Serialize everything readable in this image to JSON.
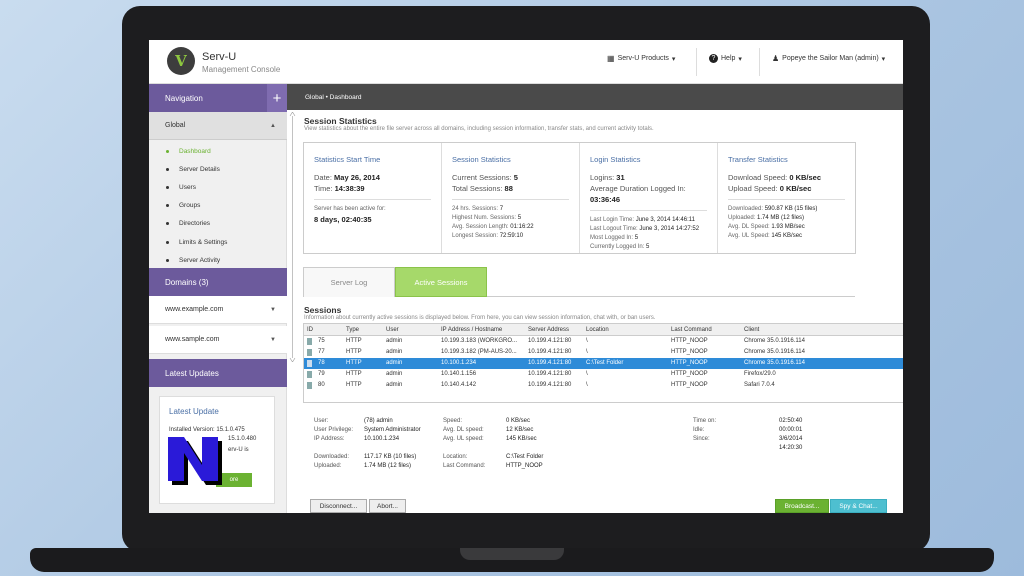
{
  "header": {
    "title": "Serv-U",
    "subtitle": "Management Console",
    "logo_letter": "V",
    "products": "Serv-U Products",
    "help": "Help",
    "user": "Popeye the Sailor Man (admin)"
  },
  "sidebar": {
    "navigation": "Navigation",
    "global": "Global",
    "items": [
      "Dashboard",
      "Server Details",
      "Users",
      "Groups",
      "Directories",
      "Limits & Settings",
      "Server Activity"
    ],
    "domains_header": "Domains (3)",
    "domains": [
      "www.example.com",
      "www.sample.com"
    ],
    "latest_header": "Latest Updates",
    "update": {
      "title": "Latest Update",
      "installed": "Installed Version: 15.1.0.475",
      "latest": "15.1.0.480",
      "is": "erv-U is",
      "btn": "ore"
    }
  },
  "breadcrumb": "Global • Dashboard",
  "session_stats": {
    "title": "Session Statistics",
    "desc": "View statistics about the entire file server across all domains, including session information, transfer stats, and current activity totals.",
    "start": {
      "title": "Statistics Start Time",
      "date_label": "Date:",
      "date": "May 26, 2014",
      "time_label": "Time:",
      "time": "14:38:39",
      "active_label": "Server has been active for:",
      "active": "8 days, 02:40:35"
    },
    "session": {
      "title": "Session Statistics",
      "current_label": "Current Sessions:",
      "current": "5",
      "total_label": "Total Sessions:",
      "total": "88",
      "l1": "24 hrs. Sessions:",
      "v1": "7",
      "l2": "Highest Num. Sessions:",
      "v2": "5",
      "l3": "Avg. Session Length:",
      "v3": "01:16:22",
      "l4": "Longest Session:",
      "v4": "72:59:10"
    },
    "login": {
      "title": "Login Statistics",
      "logins_label": "Logins:",
      "logins": "31",
      "avg_label": "Average Duration Logged In:",
      "avg": "03:36:46",
      "l1": "Last Login Time:",
      "v1": "June 3, 2014 14:46:11",
      "l2": "Last Logout Time:",
      "v2": "June 3, 2014 14:27:52",
      "l3": "Most Logged In:",
      "v3": "5",
      "l4": "Currently Logged In:",
      "v4": "5"
    },
    "transfer": {
      "title": "Transfer Statistics",
      "dl_label": "Download Speed:",
      "dl": "0 KB/sec",
      "ul_label": "Upload Speed:",
      "ul": "0 KB/sec",
      "l1": "Downloaded:",
      "v1": "590.87 KB (15 files)",
      "l2": "Uploaded:",
      "v2": "1.74 MB (12 files)",
      "l3": "Avg. DL Speed:",
      "v3": "1.93 MB/sec",
      "l4": "Avg. UL Speed:",
      "v4": "145 KB/sec"
    }
  },
  "tabs": [
    "Server Log",
    "Active Sessions"
  ],
  "sessions": {
    "title": "Sessions",
    "desc": "Information about currently active sessions is displayed below. From here, you can view session information, chat with, or ban users.",
    "columns": [
      "ID",
      "Type",
      "User",
      "IP Address / Hostname",
      "Server Address",
      "Location",
      "Last Command",
      "Client"
    ],
    "rows": [
      [
        "75",
        "HTTP",
        "admin",
        "10.199.3.183 (WORKGRO...",
        "10.199.4.121:80",
        "\\",
        "HTTP_NOOP",
        "Chrome 35.0.1916.114"
      ],
      [
        "77",
        "HTTP",
        "admin",
        "10.199.3.182 (PM-AUS-20...",
        "10.199.4.121:80",
        "\\",
        "HTTP_NOOP",
        "Chrome 35.0.1916.114"
      ],
      [
        "78",
        "HTTP",
        "admin",
        "10.100.1.234",
        "10.199.4.121:80",
        "C:\\Test Folder",
        "HTTP_NOOP",
        "Chrome 35.0.1916.114"
      ],
      [
        "79",
        "HTTP",
        "admin",
        "10.140.1.156",
        "10.199.4.121:80",
        "\\",
        "HTTP_NOOP",
        "Firefox/29.0"
      ],
      [
        "80",
        "HTTP",
        "admin",
        "10.140.4.142",
        "10.199.4.121:80",
        "\\",
        "HTTP_NOOP",
        "Safari 7.0.4"
      ]
    ]
  },
  "details": {
    "user_l": "User:",
    "user": "(78) admin",
    "priv_l": "User Privilege:",
    "priv": "System Administrator",
    "ip_l": "IP Address:",
    "ip": "10.100.1.234",
    "dl_l": "Downloaded:",
    "dl": "117.17 KB (10 files)",
    "ul_l": "Uploaded:",
    "ul": "1.74 MB (12 files)",
    "speed_l": "Speed:",
    "speed": "0 KB/sec",
    "adl_l": "Avg. DL speed:",
    "adl": "12 KB/sec",
    "aul_l": "Avg. UL speed:",
    "aul": "145 KB/sec",
    "loc_l": "Location:",
    "loc": "C:\\Test Folder",
    "cmd_l": "Last Command:",
    "cmd": "HTTP_NOOP",
    "ton_l": "Time on:",
    "ton": "02:50:40",
    "idle_l": "Idle:",
    "idle": "00:00:01",
    "since_l": "Since:",
    "since": "3/6/2014",
    "since_time": "14:20:30"
  },
  "buttons": {
    "disconnect": "Disconnect...",
    "abort": "Abort...",
    "broadcast": "Broadcast...",
    "spy": "Spy & Chat..."
  },
  "colors": {
    "purple": "#6c5a9c",
    "green": "#6bb232",
    "selection": "#2e8bd8"
  }
}
